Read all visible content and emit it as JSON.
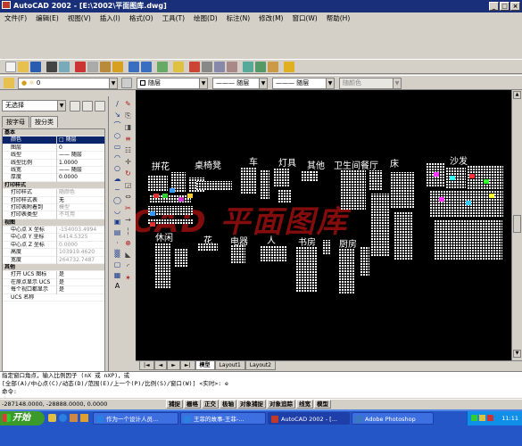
{
  "window": {
    "title": "AutoCAD 2002 - [E:\\2002\\平面图库.dwg]"
  },
  "menu": [
    "文件(F)",
    "编辑(E)",
    "视图(V)",
    "插入(I)",
    "格式(O)",
    "工具(T)",
    "绘图(D)",
    "标注(N)",
    "修改(M)",
    "窗口(W)",
    "帮助(H)"
  ],
  "layer_toolbar": {
    "layer_value": "0",
    "color_value": "随层",
    "linetype_value": "随层",
    "lineweight_value": "随层",
    "plotstyle_value": "随颜色"
  },
  "properties": {
    "selection": "无选择",
    "tabs": [
      "按字母",
      "按分类"
    ],
    "rows": [
      {
        "name": "基本",
        "value": "",
        "type": "cat"
      },
      {
        "name": "颜色",
        "value": "□ 随层",
        "type": "sel"
      },
      {
        "name": "图层",
        "value": "0",
        "type": ""
      },
      {
        "name": "线型",
        "value": "—— 随层",
        "type": ""
      },
      {
        "name": "线型比例",
        "value": "1.0000",
        "type": ""
      },
      {
        "name": "线宽",
        "value": "—— 随层",
        "type": ""
      },
      {
        "name": "厚度",
        "value": "0.0000",
        "type": ""
      },
      {
        "name": "打印样式",
        "value": "",
        "type": "cat"
      },
      {
        "name": "打印样式",
        "value": "随颜色",
        "type": "grey"
      },
      {
        "name": "打印样式表",
        "value": "无",
        "type": ""
      },
      {
        "name": "打印表附着到",
        "value": "模型",
        "type": "grey"
      },
      {
        "name": "打印表类型",
        "value": "不可用",
        "type": "grey"
      },
      {
        "name": "视图",
        "value": "",
        "type": "cat"
      },
      {
        "name": "中心点 X 坐标",
        "value": "-154003.4994",
        "type": "grey"
      },
      {
        "name": "中心点 Y 坐标",
        "value": "6414.5325",
        "type": "grey"
      },
      {
        "name": "中心点 Z 坐标",
        "value": "0.0000",
        "type": "grey"
      },
      {
        "name": "高度",
        "value": "103919.4620",
        "type": "grey"
      },
      {
        "name": "宽度",
        "value": "264732.7487",
        "type": "grey"
      },
      {
        "name": "其他",
        "value": "",
        "type": "cat"
      },
      {
        "name": "打开 UCS 图标",
        "value": "是",
        "type": ""
      },
      {
        "name": "在原点显示 UCS",
        "value": "是",
        "type": ""
      },
      {
        "name": "每个视口都显示",
        "value": "是",
        "type": ""
      },
      {
        "name": "UCS 名称",
        "value": "",
        "type": ""
      }
    ]
  },
  "drawing": {
    "labels": [
      {
        "text": "拼花"
      },
      {
        "text": "桌椅凳"
      },
      {
        "text": "车"
      },
      {
        "text": "灯具"
      },
      {
        "text": "其他"
      },
      {
        "text": "卫生间"
      },
      {
        "text": "餐厅"
      },
      {
        "text": "床"
      },
      {
        "text": "沙发"
      },
      {
        "text": "休闲"
      },
      {
        "text": "花"
      },
      {
        "text": "电器"
      },
      {
        "text": "人"
      },
      {
        "text": "书房"
      },
      {
        "text": "厨房"
      }
    ],
    "watermark": "85 CAD 平面图库"
  },
  "layout_tabs": [
    "模型",
    "Layout1",
    "Layout2"
  ],
  "command": {
    "line1": "指定窗口角点，输入比例因子 (nX 或 nXP)，或",
    "line2": "[全部(A)/中心点(C)/动态(D)/范围(E)/上一个(P)/比例(S)/窗口(W)] <实时>:  e",
    "line3": "命令:"
  },
  "status": {
    "coords": "-287148.0000,  -28888.0000,  0.0000",
    "toggles": [
      "捕捉",
      "栅格",
      "正交",
      "极轴",
      "对象捕捉",
      "对象追踪",
      "线宽",
      "模型"
    ]
  },
  "taskbar": {
    "start": "开始",
    "tasks": [
      {
        "label": "作为一个设计人员..."
      },
      {
        "label": "王菲的故事-王菲-..."
      },
      {
        "label": "AutoCAD 2002 - [..."
      },
      {
        "label": "Adobe Photoshop"
      }
    ],
    "clock": "11:11"
  }
}
